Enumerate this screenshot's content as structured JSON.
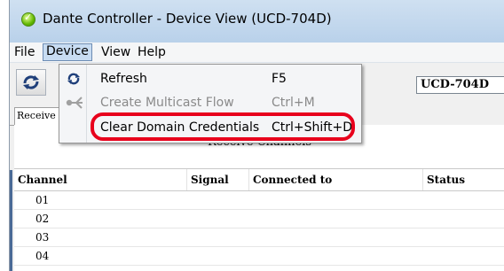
{
  "window": {
    "title": "Dante Controller - Device View (UCD-704D)"
  },
  "menubar": {
    "items": [
      "File",
      "Device",
      "View",
      "Help"
    ]
  },
  "toolbar": {
    "device_selected": "UCD-704D"
  },
  "tabs": {
    "active": "Receive"
  },
  "panel": {
    "heading": "Receive Channels",
    "columns": [
      "Channel",
      "Signal",
      "Connected to",
      "Status"
    ],
    "rows": [
      "01",
      "02",
      "03",
      "04"
    ]
  },
  "device_menu": {
    "items": [
      {
        "label": "Refresh",
        "shortcut": "F5",
        "icon": "refresh-icon",
        "enabled": true
      },
      {
        "label": "Create Multicast Flow",
        "shortcut": "Ctrl+M",
        "icon": "multicast-icon",
        "enabled": false
      },
      {
        "label": "Clear Domain Credentials",
        "shortcut": "Ctrl+Shift+D",
        "icon": "",
        "enabled": true
      }
    ]
  },
  "colors": {
    "highlight": "#e8001c",
    "menu_open": "#c8dcf2"
  }
}
